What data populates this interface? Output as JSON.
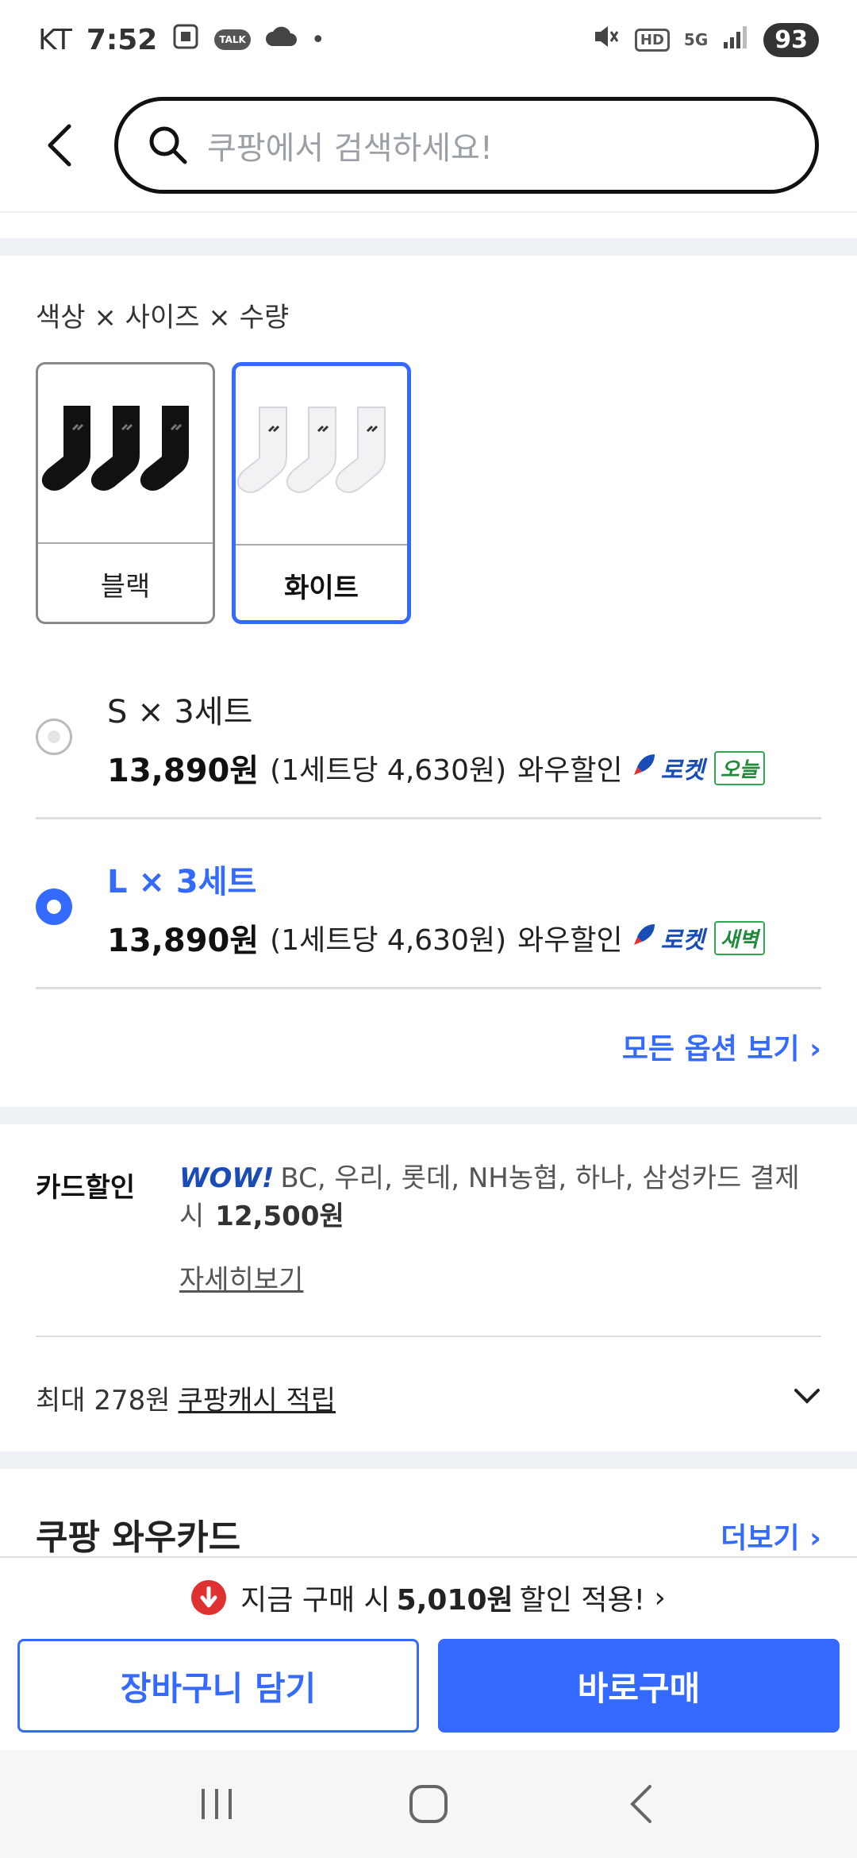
{
  "status_bar": {
    "carrier": "KT",
    "time": "7:52",
    "talk_badge": "TALK",
    "hd": "HD",
    "network": "5G",
    "battery": "93"
  },
  "header": {
    "search_placeholder": "쿠팡에서 검색하세요!"
  },
  "options": {
    "section_title": "색상 × 사이즈 × 수량",
    "colors": [
      {
        "label": "블랙",
        "selected": false
      },
      {
        "label": "화이트",
        "selected": true
      }
    ],
    "sizes": [
      {
        "name": "S × 3세트",
        "price": "13,890원",
        "per_set": "(1세트당 4,630원)",
        "discount": "와우할인",
        "rocket": "로켓",
        "delivery": "오늘",
        "selected": false
      },
      {
        "name": "L × 3세트",
        "price": "13,890원",
        "per_set": "(1세트당 4,630원)",
        "discount": "와우할인",
        "rocket": "로켓",
        "delivery": "새벽",
        "selected": true
      }
    ],
    "all_options_label": "모든 옵션 보기"
  },
  "card_discount": {
    "label": "카드할인",
    "wow": "WOW!",
    "text": "BC, 우리, 롯데, NH농협, 하나, 삼성카드 결제 시",
    "price": "12,500원",
    "detail_link": "자세히보기"
  },
  "cashback": {
    "prefix": "최대 278원",
    "link": "쿠팡캐시 적립"
  },
  "wow_card": {
    "title": "쿠팡 와우카드",
    "more": "더보기"
  },
  "bottom": {
    "promo_prefix": "지금 구매 시",
    "promo_amount": "5,010원",
    "promo_suffix": "할인 적용!",
    "cart_button": "장바구니 담기",
    "buy_button": "바로구매"
  },
  "colors": {
    "accent": "#346aff",
    "rocket": "#1a4cb8",
    "badge_green": "#1e8a3a",
    "promo_red": "#e03131"
  }
}
